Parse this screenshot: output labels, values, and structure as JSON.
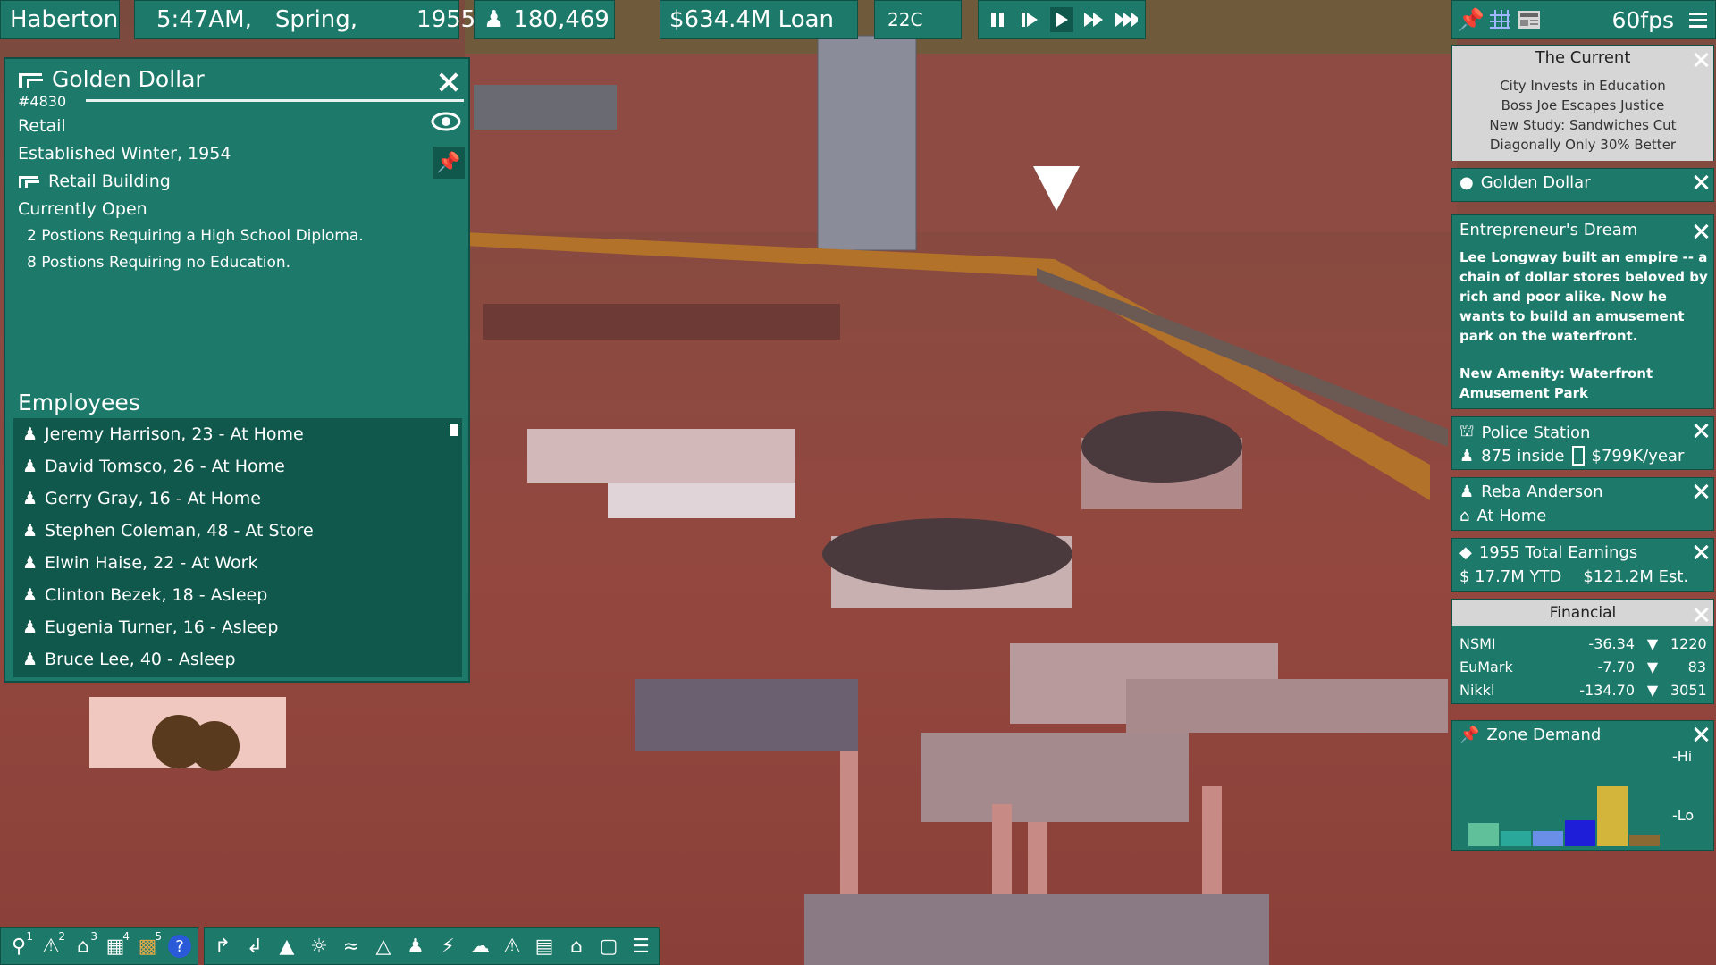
{
  "topbar": {
    "city": "Haberton",
    "time": "5:47AM,",
    "season": "Spring,",
    "year": "1955",
    "population": "180,469",
    "loan": "$634.4M Loan",
    "temperature": "22C",
    "fps": "60fps"
  },
  "info_panel": {
    "title": "Golden Dollar",
    "id": "#4830",
    "category": "Retail",
    "established": "Established Winter, 1954",
    "building_type": "Retail Building",
    "status": "Currently Open",
    "positions": [
      "2 Postions Requiring a High School Diploma.",
      "8 Postions Requiring no Education."
    ],
    "employees_title": "Employees",
    "employees": [
      "Jeremy Harrison, 23 - At Home",
      "David Tomsco, 26 - At Home",
      "Gerry Gray, 16 - At Home",
      "Stephen Coleman, 48 - At Store",
      "Elwin Haise, 22 - At Work",
      "Clinton Bezek, 18 - Asleep",
      "Eugenia Turner, 16 - Asleep",
      "Bruce Lee, 40 - Asleep"
    ]
  },
  "news": {
    "title": "The Current",
    "headlines": [
      "City Invests in Education",
      "Boss Joe Escapes Justice",
      "New Study: Sandwiches Cut",
      "Diagonally Only 30% Better"
    ]
  },
  "golden_dollar_panel": {
    "title": "Golden Dollar"
  },
  "entrepreneur": {
    "title": "Entrepreneur's Dream",
    "story": "Lee Longway built an empire -- a chain of dollar stores beloved by rich and poor alike. Now he wants to build an amusement park on the waterfront.",
    "amenity": "New Amenity: Waterfront Amusement Park"
  },
  "police": {
    "title": "Police Station",
    "inside": "875 inside",
    "budget": "$799K/year"
  },
  "citizen": {
    "name": "Reba Anderson",
    "location": "At Home"
  },
  "earnings": {
    "title": "1955 Total Earnings",
    "ytd": "$ 17.7M YTD",
    "est": "$121.2M Est."
  },
  "financial": {
    "title": "Financial",
    "rows": [
      {
        "name": "NSMI",
        "value": "-36.34",
        "count": "1220"
      },
      {
        "name": "EuMark",
        "value": "-7.70",
        "count": "83"
      },
      {
        "name": "Nikkl",
        "value": "-134.70",
        "count": "3051"
      }
    ]
  },
  "zone_demand": {
    "title": "Zone Demand",
    "hi": "-Hi",
    "lo": "-Lo",
    "bars": [
      {
        "zone": "residential-low",
        "level": 0.27,
        "color": "#5fc09a"
      },
      {
        "zone": "residential-high",
        "level": 0.18,
        "color": "#2aa89a"
      },
      {
        "zone": "commercial-low",
        "level": 0.18,
        "color": "#6a8fe8"
      },
      {
        "zone": "commercial-high",
        "level": 0.3,
        "color": "#1e1ed8"
      },
      {
        "zone": "industrial-low",
        "level": 0.7,
        "color": "#d2b53a"
      },
      {
        "zone": "industrial-high",
        "level": 0.14,
        "color": "#8a6a32"
      }
    ]
  },
  "toolbar": {
    "group1": [
      "1",
      "2",
      "3",
      "4",
      "5"
    ]
  }
}
